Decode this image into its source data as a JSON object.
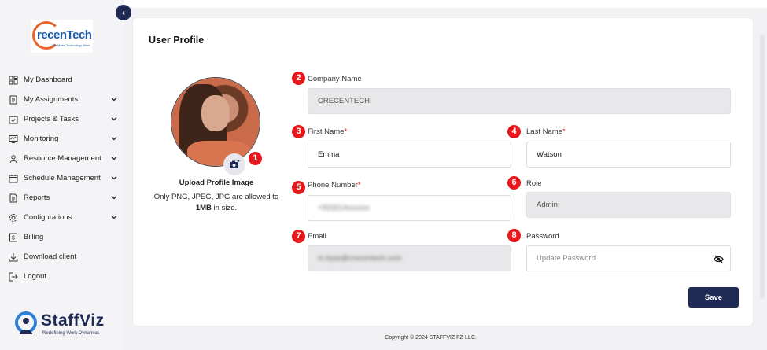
{
  "brand": {
    "company_logo_text": "recenTech",
    "company_logo_tagline": "We Make Technology Work",
    "product_name": "StaffViz",
    "product_tagline": "Redefining Work Dynamics"
  },
  "sidebar": {
    "items": [
      {
        "label": "My Dashboard",
        "icon": "dashboard-icon",
        "has_submenu": false
      },
      {
        "label": "My Assignments",
        "icon": "assignments-icon",
        "has_submenu": true
      },
      {
        "label": "Projects & Tasks",
        "icon": "projects-icon",
        "has_submenu": true
      },
      {
        "label": "Monitoring",
        "icon": "monitoring-icon",
        "has_submenu": true
      },
      {
        "label": "Resource Management",
        "icon": "resource-icon",
        "has_submenu": true
      },
      {
        "label": "Schedule Management",
        "icon": "schedule-icon",
        "has_submenu": true
      },
      {
        "label": "Reports",
        "icon": "reports-icon",
        "has_submenu": true
      },
      {
        "label": "Configurations",
        "icon": "configurations-icon",
        "has_submenu": true
      },
      {
        "label": "Billing",
        "icon": "billing-icon",
        "has_submenu": false
      },
      {
        "label": "Download client",
        "icon": "download-icon",
        "has_submenu": false
      },
      {
        "label": "Logout",
        "icon": "logout-icon",
        "has_submenu": false
      }
    ]
  },
  "profile": {
    "title": "User Profile",
    "upload_title": "Upload Profile Image",
    "upload_note_prefix": "Only PNG, JPEG, JPG are allowed to ",
    "upload_note_limit": "1MB",
    "upload_note_suffix": " in size.",
    "badges": [
      "1",
      "2",
      "3",
      "4",
      "5",
      "6",
      "7",
      "8"
    ],
    "fields": {
      "company_name": {
        "label": "Company Name",
        "value": "CRECENTECH"
      },
      "first_name": {
        "label": "First Name",
        "required_mark": "*",
        "value": "Emma"
      },
      "last_name": {
        "label": "Last Name",
        "required_mark": "*",
        "value": "Watson"
      },
      "phone_number": {
        "label": "Phone Number",
        "required_mark": "*",
        "value": "+923214xxxxxx"
      },
      "role": {
        "label": "Role",
        "value": "Admin"
      },
      "email": {
        "label": "Email",
        "value": "m.ilyas@crecentech.com"
      },
      "password": {
        "label": "Password",
        "placeholder": "Update Password"
      }
    },
    "save_label": "Save"
  },
  "footer": {
    "text": "Copyright © 2024 STAFFVIZ FZ-LLC."
  },
  "colors": {
    "primary": "#1f2a55",
    "badge": "#e8171b",
    "accent": "#e8642c"
  }
}
